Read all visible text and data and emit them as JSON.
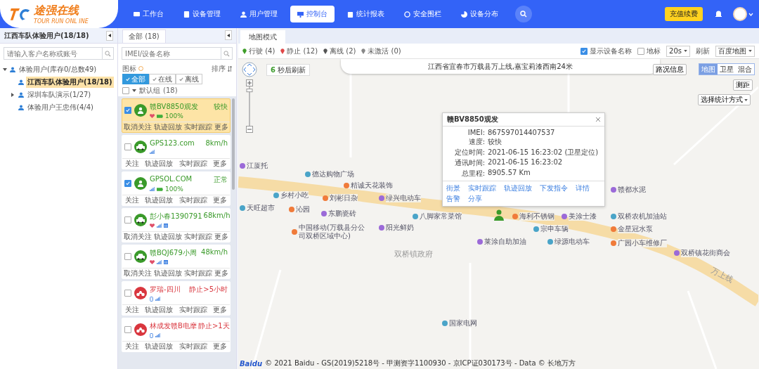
{
  "header": {
    "logo": {
      "title": "途强在线",
      "subtitle": "TOUR RUN ONL INE"
    },
    "nav": [
      {
        "label": "工作台",
        "selected": false
      },
      {
        "label": "设备管理",
        "selected": false
      },
      {
        "label": "用户管理",
        "selected": false
      },
      {
        "label": "控制台",
        "selected": true
      },
      {
        "label": "统计报表",
        "selected": false
      },
      {
        "label": "安全围栏",
        "selected": false
      },
      {
        "label": "设备分布",
        "selected": false
      }
    ],
    "recharge": "充值续费"
  },
  "customers": {
    "title": "江西车队体验用户(18/18)",
    "search": {
      "placeholder": "请输入客户名称或账号"
    },
    "tree": [
      {
        "label": "体验用户(库存0/总数49)",
        "expanded": true,
        "selected": false,
        "children": [
          {
            "label": "江西车队体验用户(18/18)",
            "selected": true
          },
          {
            "label": "深圳车队演示(1/27)",
            "selected": false,
            "expanded": false
          },
          {
            "label": "体验用户王忠伟(4/4)",
            "selected": false
          }
        ]
      }
    ]
  },
  "devices": {
    "tab": "全部 (18)",
    "search": {
      "placeholder": "IMEI/设备名称"
    },
    "icon_label": "图标",
    "sort": "排序",
    "filters": [
      {
        "label": "全部",
        "selected": true
      },
      {
        "label": "在线",
        "selected": false
      },
      {
        "label": "离线",
        "selected": false
      }
    ],
    "group": {
      "name": "默认组",
      "count": "(18)",
      "checked": false,
      "expanded": true
    },
    "items": [
      {
        "name": "赣BV8850观发",
        "status": "较快",
        "kind": "person",
        "online": true,
        "checked": true,
        "selected": true,
        "indicators": [
          {
            "kind": "heart"
          },
          {
            "kind": "battery"
          }
        ],
        "battery": "100%",
        "actions": [
          "取消关注",
          "轨迹回放",
          "实时跟踪",
          "更多"
        ]
      },
      {
        "name": "GPS123.com",
        "status": "8km/h",
        "kind": "car",
        "online": true,
        "checked": false,
        "selected": false,
        "indicators": [
          {
            "kind": "signal"
          }
        ],
        "actions": [
          "关注",
          "轨迹回放",
          "实时跟踪",
          "更多"
        ]
      },
      {
        "name": "GPSOL.COM",
        "status": "正常",
        "kind": "person",
        "online": true,
        "checked": true,
        "selected": false,
        "indicators": [
          {
            "kind": "signal"
          },
          {
            "kind": "battery"
          }
        ],
        "battery": "100%",
        "actions": [
          "关注",
          "轨迹回放",
          "实时跟踪",
          "更多"
        ]
      },
      {
        "name": "彭小春1390791",
        "status": "68km/h",
        "kind": "car",
        "online": true,
        "checked": false,
        "selected": false,
        "indicators": [
          {
            "kind": "heart"
          },
          {
            "kind": "signal"
          },
          {
            "kind": "sim"
          }
        ],
        "actions": [
          "取消关注",
          "轨迹回放",
          "实时跟踪",
          "更多"
        ]
      },
      {
        "name": "赣BQJ679小周",
        "status": "48km/h",
        "kind": "car",
        "online": true,
        "checked": false,
        "selected": false,
        "indicators": [
          {
            "kind": "heart"
          },
          {
            "kind": "signal"
          },
          {
            "kind": "sim"
          }
        ],
        "actions": [
          "取消关注",
          "轨迹回放",
          "实时跟踪",
          "更多"
        ]
      },
      {
        "name": "罗瑞-四川",
        "status": "静止>5小时",
        "kind": "moto",
        "online": false,
        "checked": false,
        "selected": false,
        "indicators": [
          {
            "kind": "phone"
          },
          {
            "kind": "signal"
          }
        ],
        "actions": [
          "关注",
          "轨迹回放",
          "实时跟踪",
          "更多"
        ]
      },
      {
        "name": "林成发赣B电摩",
        "status": "静止>1天",
        "kind": "moto",
        "online": false,
        "checked": false,
        "selected": false,
        "indicators": [
          {
            "kind": "phone"
          },
          {
            "kind": "signal"
          }
        ],
        "actions": [
          "关注",
          "轨迹回放",
          "实时跟踪",
          "更多"
        ]
      }
    ]
  },
  "map": {
    "tab": "地图模式",
    "legend": [
      {
        "label": "行驶 (4)",
        "color": "#3f9e2a"
      },
      {
        "label": "静止 (12)",
        "color": "#e04848"
      },
      {
        "label": "离线 (2)",
        "color": "#555555"
      },
      {
        "label": "未激活 (0)",
        "color": "#888888"
      }
    ],
    "show_names": {
      "label": "显示设备名称",
      "checked": true
    },
    "landmark": {
      "label": "地标",
      "checked": false
    },
    "interval": "20s",
    "refresh": "刷新",
    "provider": "百度地图",
    "countdown": "**6** 秒后刷新",
    "address": "江西省宜春市万载县万上线,嘉宝莉漆西南24米",
    "traffic": "路况信息",
    "map_types": [
      {
        "label": "地图",
        "selected": true
      },
      {
        "label": "卫星",
        "selected": false
      },
      {
        "label": "混合",
        "selected": false
      }
    ],
    "zoom": {
      "level": 0.93
    },
    "measure": "测距",
    "stat_select": "选择统计方式",
    "popup": {
      "title": "赣BV8850观发",
      "rows": [
        {
          "label": "IMEI:",
          "value": "867597014407537"
        },
        {
          "label": "速度:",
          "value": "较快"
        },
        {
          "label": "定位时间:",
          "value": "2021-06-15 16:23:02 (卫星定位)"
        },
        {
          "label": "通讯时间:",
          "value": "2021-06-15 16:23:02"
        },
        {
          "label": "总里程:",
          "value": "8905.57 Km"
        }
      ],
      "links": [
        "街景",
        "实时跟踪",
        "轨迹回放",
        "下发指令",
        "详情",
        "告警",
        "分享"
      ]
    },
    "places": [
      "江厦托",
      "德达购物广场",
      "精诚天花装饰",
      "赣都水泥",
      "乡村小吃",
      "刘彬日杂",
      "绿兴电动车",
      "天旺超市",
      "沁园",
      "东鹏瓷砖",
      "八脚家常菜馆",
      "海利不锈钢",
      "美涂士漆",
      "双桥农机加油站",
      "中国移动(万载县分公司双桥区域中心)",
      "阳光鲜奶",
      "宗申车辆",
      "金星冠水泵",
      "莱涂自助加油",
      "绿源电动车",
      "广园小车维修厂",
      "双桥镇花街商会",
      "国家电网"
    ],
    "area_labels": [
      "双桥镇政府",
      "万上线"
    ],
    "copyright": "© 2021 Baidu - GS(2019)5218号 - 甲测资字1100930 - 京ICP证030173号 - Data © 长地万方",
    "baidu": "Baidu"
  }
}
